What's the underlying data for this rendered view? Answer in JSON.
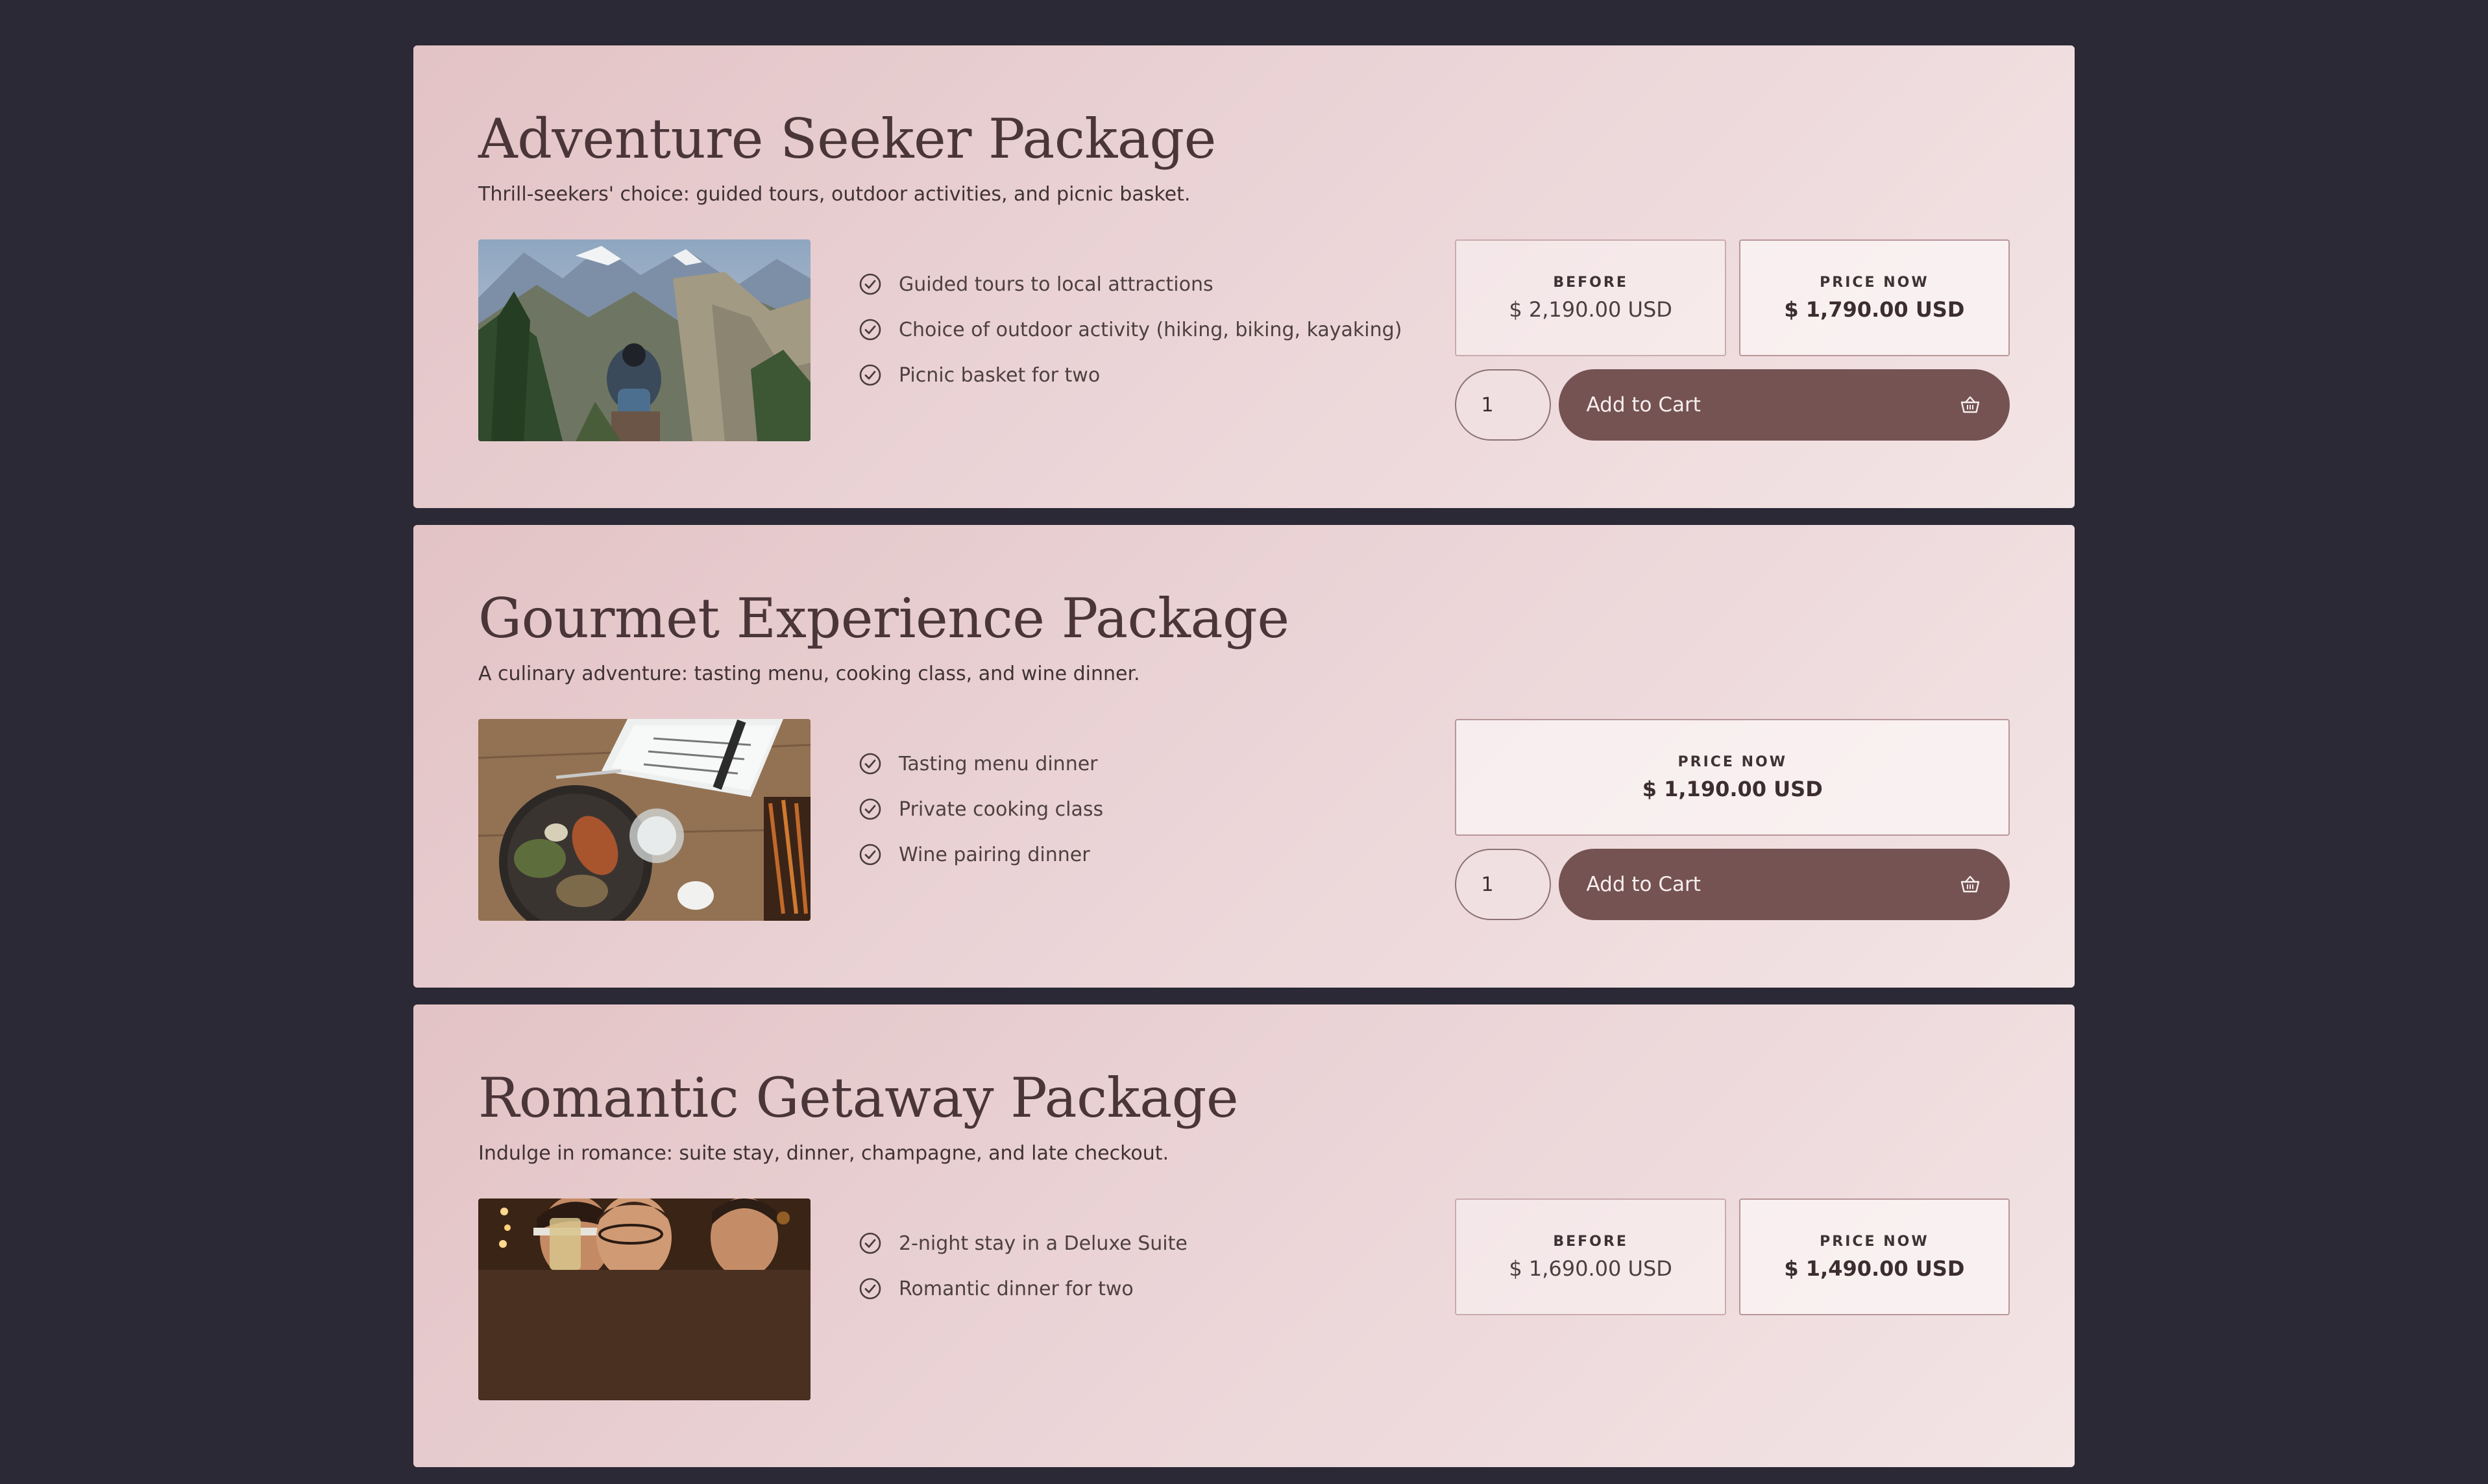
{
  "packages": [
    {
      "title": "Adventure Seeker Package",
      "description": "Thrill-seekers' choice: guided tours, outdoor activities, and picnic basket.",
      "image_alt": "Hiker looking over a mountain valley",
      "features": [
        "Guided tours to local attractions",
        "Choice of outdoor activity (hiking, biking, kayaking)",
        "Picnic basket for two"
      ],
      "before_label": "BEFORE",
      "before_price": "$ 2,190.00 USD",
      "now_label": "PRICE NOW",
      "now_price": "$ 1,790.00 USD",
      "quantity": "1",
      "add_to_cart": "Add to Cart"
    },
    {
      "title": "Gourmet Experience Package",
      "description": "A culinary adventure: tasting menu, cooking class, and wine dinner.",
      "image_alt": "Table with menu, plated dishes and wine glass",
      "features": [
        "Tasting menu dinner",
        "Private cooking class",
        "Wine pairing dinner"
      ],
      "now_label": "PRICE NOW",
      "now_price": "$ 1,190.00 USD",
      "quantity": "1",
      "add_to_cart": "Add to Cart"
    },
    {
      "title": "Romantic Getaway Package",
      "description": "Indulge in romance: suite stay, dinner, champagne, and late checkout.",
      "image_alt": "Couple celebrating with drinks",
      "features": [
        "2-night stay in a Deluxe Suite",
        "Romantic dinner for two"
      ],
      "before_label": "BEFORE",
      "before_price": "$ 1,690.00 USD",
      "now_label": "PRICE NOW",
      "now_price": "$ 1,490.00 USD"
    }
  ],
  "icons": {
    "feature": "check-circle-icon",
    "cart": "basket-icon"
  },
  "colors": {
    "page_background": "#2a2935",
    "card_background": "#ead3d6",
    "button": "#745352",
    "heading_text": "#4a3538"
  }
}
